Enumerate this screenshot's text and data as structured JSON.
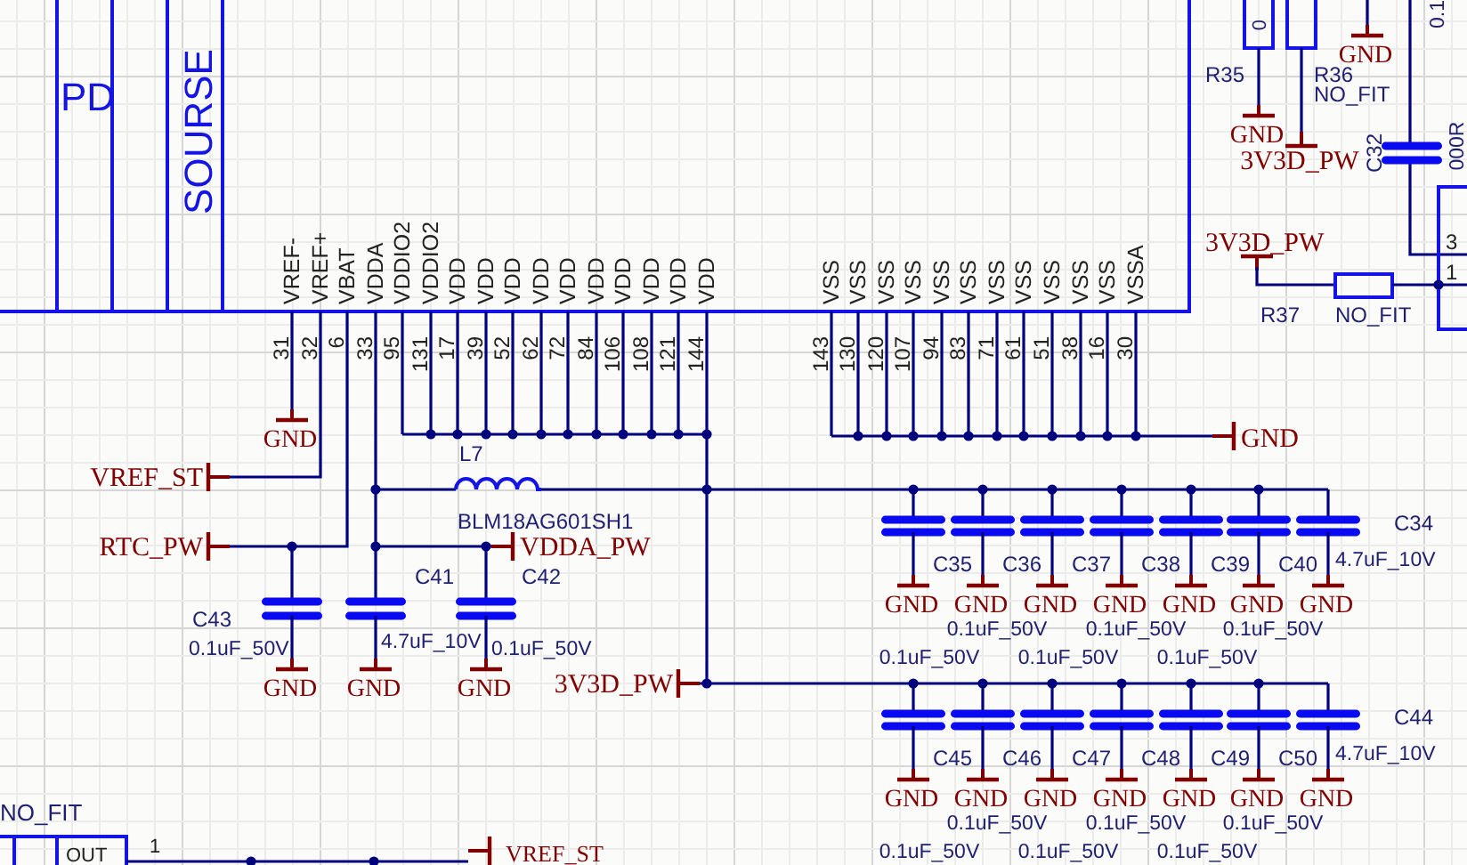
{
  "chip": {
    "section_labels": [
      "PD",
      "SOURSE"
    ],
    "supply_pins": [
      {
        "name": "VREF-",
        "number": "31"
      },
      {
        "name": "VREF+",
        "number": "32"
      },
      {
        "name": "VBAT",
        "number": "6"
      },
      {
        "name": "VDDA",
        "number": "33"
      },
      {
        "name": "VDDIO2",
        "number": "95"
      },
      {
        "name": "VDDIO2",
        "number": "131"
      },
      {
        "name": "VDD",
        "number": "17"
      },
      {
        "name": "VDD",
        "number": "39"
      },
      {
        "name": "VDD",
        "number": "52"
      },
      {
        "name": "VDD",
        "number": "62"
      },
      {
        "name": "VDD",
        "number": "72"
      },
      {
        "name": "VDD",
        "number": "84"
      },
      {
        "name": "VDD",
        "number": "106"
      },
      {
        "name": "VDD",
        "number": "108"
      },
      {
        "name": "VDD",
        "number": "121"
      },
      {
        "name": "VDD",
        "number": "144"
      }
    ],
    "ground_pins": [
      {
        "name": "VSS",
        "number": "143"
      },
      {
        "name": "VSS",
        "number": "130"
      },
      {
        "name": "VSS",
        "number": "120"
      },
      {
        "name": "VSS",
        "number": "107"
      },
      {
        "name": "VSS",
        "number": "94"
      },
      {
        "name": "VSS",
        "number": "83"
      },
      {
        "name": "VSS",
        "number": "71"
      },
      {
        "name": "VSS",
        "number": "61"
      },
      {
        "name": "VSS",
        "number": "51"
      },
      {
        "name": "VSS",
        "number": "38"
      },
      {
        "name": "VSS",
        "number": "16"
      },
      {
        "name": "VSSA",
        "number": "30"
      }
    ]
  },
  "ports": [
    {
      "label": "GND"
    },
    {
      "label": "VREF_ST"
    },
    {
      "label": "RTC_PW"
    },
    {
      "label": "VDDA_PW"
    },
    {
      "label": "3V3D_PW"
    },
    {
      "label": "GND"
    }
  ],
  "ferrite": {
    "ref": "L7",
    "part": "BLM18AG601SH1"
  },
  "analog_caps": [
    {
      "ref": "C43",
      "value": "0.1uF_50V",
      "ground": "GND"
    },
    {
      "ref": "C41",
      "value": "4.7uF_10V",
      "ground": "GND"
    },
    {
      "ref": "C42",
      "value": "0.1uF_50V",
      "ground": "GND"
    }
  ],
  "bank_1": [
    {
      "ref": "C35",
      "value": "0.1uF_50V",
      "ground": "GND"
    },
    {
      "ref": "C36",
      "value": "0.1uF_50V",
      "ground": "GND"
    },
    {
      "ref": "C37",
      "value": "0.1uF_50V",
      "ground": "GND"
    },
    {
      "ref": "C38",
      "value": "0.1uF_50V",
      "ground": "GND"
    },
    {
      "ref": "C39",
      "value": "0.1uF_50V",
      "ground": "GND"
    },
    {
      "ref": "C40",
      "value": "0.1uF_50V",
      "ground": "GND"
    },
    {
      "ref": "C34",
      "value": "4.7uF_10V",
      "ground": "GND"
    }
  ],
  "bank_2": [
    {
      "ref": "C45",
      "value": "0.1uF_50V",
      "ground": "GND"
    },
    {
      "ref": "C46",
      "value": "0.1uF_50V",
      "ground": "GND"
    },
    {
      "ref": "C47",
      "value": "0.1uF_50V",
      "ground": "GND"
    },
    {
      "ref": "C48",
      "value": "0.1uF_50V",
      "ground": "GND"
    },
    {
      "ref": "C49",
      "value": "0.1uF_50V",
      "ground": "GND"
    },
    {
      "ref": "C50",
      "value": "0.1uF_50V",
      "ground": "GND"
    },
    {
      "ref": "C44",
      "value": "4.7uF_10V",
      "ground": "GND"
    }
  ],
  "top_right": {
    "r35": {
      "ref": "R35",
      "value": "0",
      "ground": "GND"
    },
    "r36": {
      "ref": "R36",
      "value": "NO_FIT",
      "net": "3V3D_PW"
    },
    "ground": "GND",
    "c32": {
      "ref": "C32"
    },
    "texts": [
      "0.1",
      "000R"
    ],
    "connector_pins": [
      "3",
      "1"
    ],
    "r37": {
      "ref": "R37",
      "value": "NO_FIT",
      "net": "3V3D_PW"
    }
  },
  "bottom_left": {
    "value": "NO_FIT",
    "pin_label": "OUT",
    "pin_number": "1",
    "net": "VREF_ST"
  }
}
